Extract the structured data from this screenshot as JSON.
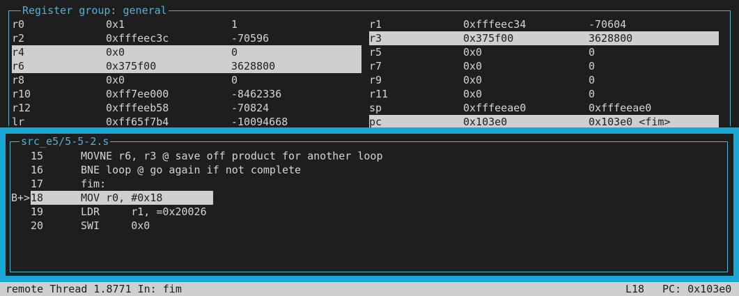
{
  "registers": {
    "title": "Register group: general",
    "left": [
      {
        "name": "r0",
        "hex": "0x1",
        "natural": "1",
        "highlighted": false
      },
      {
        "name": "r2",
        "hex": "0xfffeec3c",
        "natural": "-70596",
        "highlighted": false
      },
      {
        "name": "r4",
        "hex": "0x0",
        "natural": "0",
        "highlighted": true
      },
      {
        "name": "r6",
        "hex": "0x375f00",
        "natural": "3628800",
        "highlighted": true
      },
      {
        "name": "r8",
        "hex": "0x0",
        "natural": "0",
        "highlighted": false
      },
      {
        "name": "r10",
        "hex": "0xff7ee000",
        "natural": "-8462336",
        "highlighted": false
      },
      {
        "name": "r12",
        "hex": "0xfffeeb58",
        "natural": "-70824",
        "highlighted": false
      },
      {
        "name": "lr",
        "hex": "0xff65f7b4",
        "natural": "-10094668",
        "highlighted": false
      }
    ],
    "right": [
      {
        "name": "r1",
        "hex": "0xfffeec34",
        "natural": "-70604",
        "highlighted": false
      },
      {
        "name": "r3",
        "hex": "0x375f00",
        "natural": "3628800",
        "highlighted": true
      },
      {
        "name": "r5",
        "hex": "0x0",
        "natural": "0",
        "highlighted": false
      },
      {
        "name": "r7",
        "hex": "0x0",
        "natural": "0",
        "highlighted": false
      },
      {
        "name": "r9",
        "hex": "0x0",
        "natural": "0",
        "highlighted": false
      },
      {
        "name": "r11",
        "hex": "0x0",
        "natural": "0",
        "highlighted": false
      },
      {
        "name": "sp",
        "hex": "0xfffeeae0",
        "natural": "0xfffeeae0",
        "highlighted": false
      },
      {
        "name": "pc",
        "hex": "0x103e0",
        "natural": "0x103e0 <fim>",
        "highlighted": true
      }
    ]
  },
  "source": {
    "title": "src_e5/5-5-2.s",
    "lines": [
      {
        "marker": "",
        "number": "15",
        "code": "MOVNE r6, r3 @ save off product for another loop",
        "current": false
      },
      {
        "marker": "",
        "number": "16",
        "code": "BNE loop @ go again if not complete",
        "current": false
      },
      {
        "marker": "",
        "number": "17",
        "code": "fim:",
        "current": false
      },
      {
        "marker": "B+>",
        "number": "18",
        "code": "MOV r0, #0x18",
        "current": true
      },
      {
        "marker": "",
        "number": "19",
        "code": "LDR     r1, =0x20026",
        "current": false
      },
      {
        "marker": "",
        "number": "20",
        "code": "SWI     0x0",
        "current": false
      }
    ]
  },
  "status": {
    "left": "remote Thread 1.8771 In: fim",
    "line": "L18",
    "pc": "PC: 0x103e0"
  },
  "colors": {
    "background": "#1e1e1e",
    "border": "#4fb3d6",
    "focus_frame": "#18a9d6",
    "highlight": "#cfcfcf",
    "text": "#d4d4d4"
  }
}
